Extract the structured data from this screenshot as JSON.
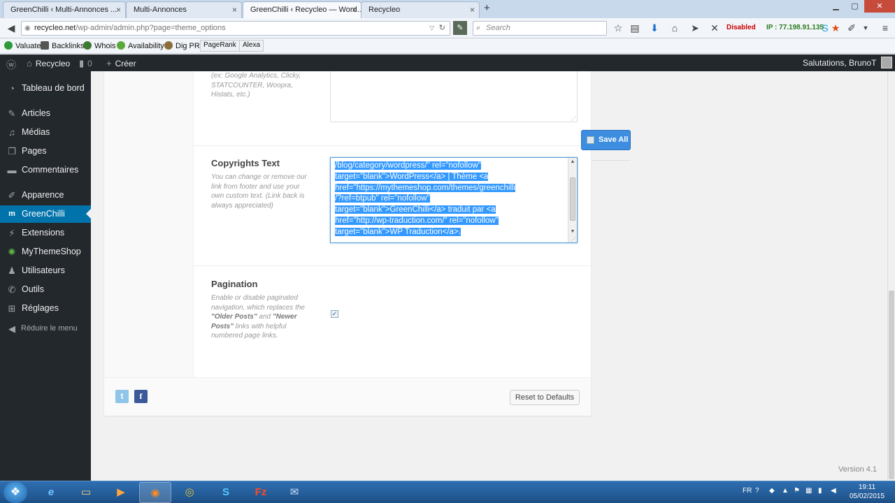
{
  "browser": {
    "tabs": [
      {
        "label": "GreenChilli ‹ Multi-Annonces ...",
        "active": false
      },
      {
        "label": "Multi-Annonces",
        "active": false
      },
      {
        "label": "GreenChilli ‹ Recycleo — Word...",
        "active": true
      },
      {
        "label": "Recycleo",
        "active": false
      }
    ],
    "tab_close": "×",
    "new_tab": "+",
    "url_host": "recycleo.net",
    "url_path": "/wp-admin/admin.php?page=theme_options",
    "search_placeholder": "Search",
    "status_disabled": "Disabled",
    "ip_text": "IP : 77.198.91.135"
  },
  "bookmarks": [
    "Valuate",
    "Backlinks",
    "Whois",
    "Availability",
    "Dig PR",
    "PageRank",
    "Alexa"
  ],
  "adminbar": {
    "site_name": "Recycleo",
    "comments_count": "0",
    "new_label": "Créer",
    "greeting": "Salutations, BrunoT"
  },
  "sidebar": {
    "items": [
      {
        "label": "Tableau de bord",
        "icon": "dashboard-icon"
      },
      {
        "label": "Articles",
        "icon": "pin-icon"
      },
      {
        "label": "Médias",
        "icon": "media-icon"
      },
      {
        "label": "Pages",
        "icon": "pages-icon"
      },
      {
        "label": "Commentaires",
        "icon": "comment-icon"
      },
      {
        "label": "Apparence",
        "icon": "brush-icon"
      },
      {
        "label": "GreenChilli",
        "icon": "theme-icon"
      },
      {
        "label": "Extensions",
        "icon": "plugin-icon"
      },
      {
        "label": "MyThemeShop",
        "icon": "mythemeshop-icon"
      },
      {
        "label": "Utilisateurs",
        "icon": "user-icon"
      },
      {
        "label": "Outils",
        "icon": "wrench-icon"
      },
      {
        "label": "Réglages",
        "icon": "settings-icon"
      }
    ],
    "collapse_label": "Réduire le menu",
    "current": "GreenChilli"
  },
  "options": {
    "tracking": {
      "desc": "(ex: Google Analytics, Clicky, STATCOUNTER, Woopra, Histats, etc.)"
    },
    "copyrights": {
      "title": "Copyrights Text",
      "desc": "You can change or remove our link from footer and use your own custom text. (Link back is always appreciated)",
      "value_lines": [
        "/blog/category/wordpress/\" rel=\"nofollow\"",
        "target=\"blank\">WordPress</a> | Thème <a",
        "href=\"https://mythemeshop.com/themes/greenchilli",
        "/?ref=btpub\" rel=\"nofollow\"",
        "target=\"blank\">GreenChilli</a> traduit par <a",
        "href=\"http://wp-traduction.com/\" rel=\"nofollow\"",
        "target=\"blank\">WP Traduction</a>."
      ]
    },
    "pagination": {
      "title": "Pagination",
      "desc_1": "Enable or disable paginated navigation, which replaces the ",
      "desc_older": "\"Older Posts\"",
      "desc_2": " and ",
      "desc_newer": "\"Newer Posts\"",
      "desc_3": " links with helpful numbered page links.",
      "checked": true
    }
  },
  "buttons": {
    "save_all": "Save All",
    "reset": "Reset to Defaults"
  },
  "footer": {
    "version": "Version 4.1"
  },
  "taskbar": {
    "lang": "FR",
    "time": "19:11",
    "date": "05/02/2015"
  }
}
